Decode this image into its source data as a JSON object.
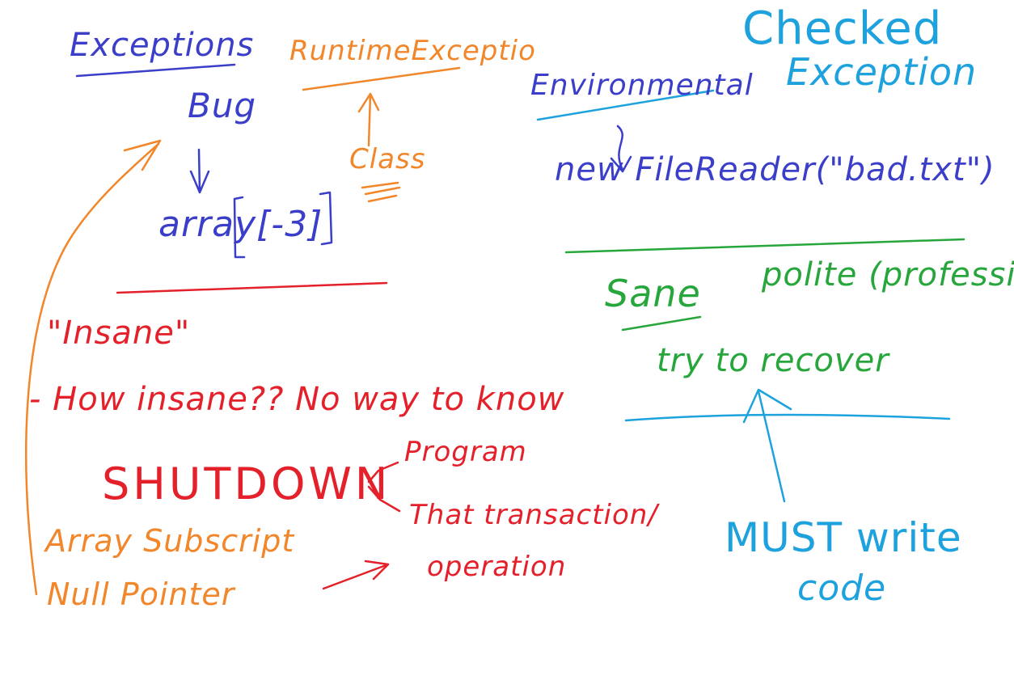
{
  "colors": {
    "blue": "#3a3ec9",
    "orange": "#f2862a",
    "lightblue": "#1ea2de",
    "red": "#e4202a",
    "green": "#27a63c"
  },
  "left": {
    "heading": "Exceptions",
    "bug": "Bug",
    "example": "array[-3]",
    "runtime": "RuntimeExceptio",
    "class": "Class",
    "insane_quote": "\"Insane\"",
    "how_insane": "- How insane?? No way to know",
    "shutdown": "SHUTDOWN",
    "program": "Program",
    "transaction": "That transaction/",
    "operation": "operation",
    "array_subscript": "Array Subscript",
    "null_pointer": "Null Pointer"
  },
  "right": {
    "checked1": "Checked",
    "checked2": "Exception",
    "environmental": "Environmental",
    "filereader": "new FileReader(\"bad.txt\")",
    "sane": "Sane",
    "polite": "polite (professional)",
    "try_recover": "try to recover",
    "must_write": "MUST write",
    "code": "code"
  }
}
